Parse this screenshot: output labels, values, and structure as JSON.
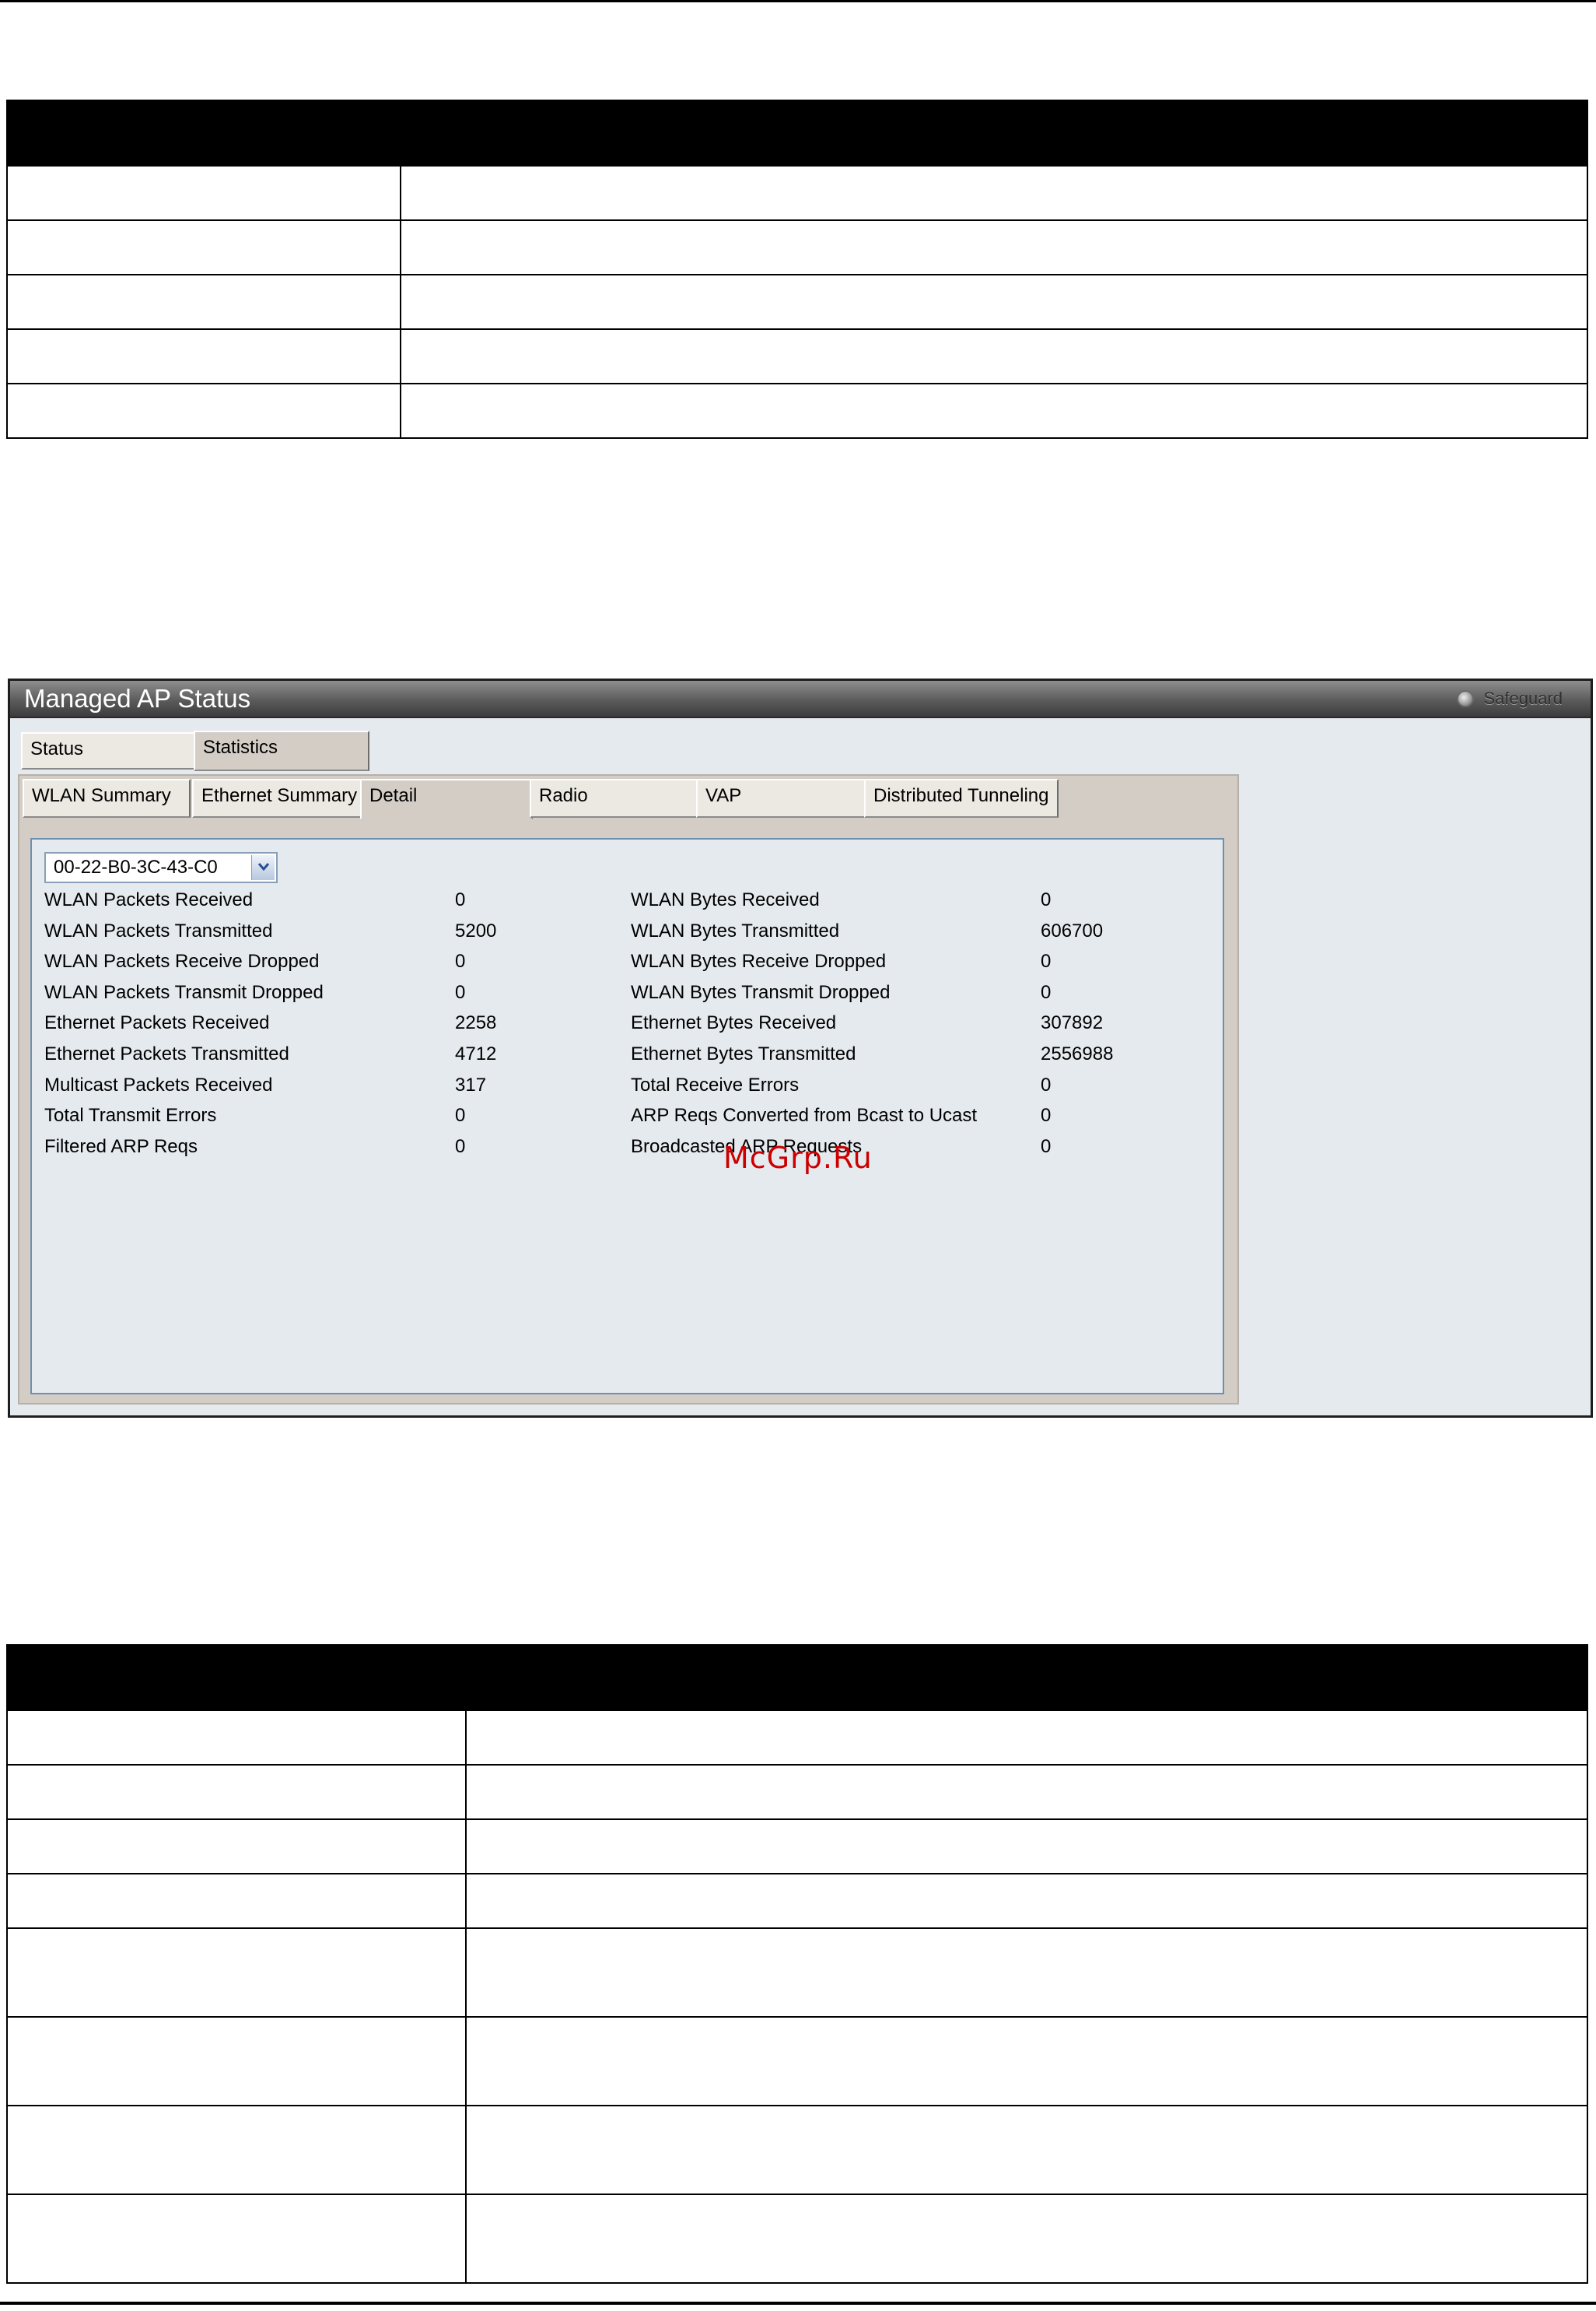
{
  "window": {
    "title": "Managed AP Status",
    "safeguard_label": "Safeguard"
  },
  "tabs": [
    {
      "label": "Status",
      "active": false
    },
    {
      "label": "Statistics",
      "active": true
    }
  ],
  "subtabs": [
    {
      "label": "WLAN Summary"
    },
    {
      "label": "Ethernet Summary"
    },
    {
      "label": "Detail",
      "active": true
    },
    {
      "label": "Radio"
    },
    {
      "label": "VAP"
    },
    {
      "label": "Distributed Tunneling"
    }
  ],
  "ap_select": {
    "value": "00-22-B0-3C-43-C0"
  },
  "stats_left": [
    {
      "label": "WLAN Packets Received",
      "value": "0"
    },
    {
      "label": "WLAN Packets Transmitted",
      "value": "5200"
    },
    {
      "label": "WLAN Packets Receive Dropped",
      "value": "0"
    },
    {
      "label": "WLAN Packets Transmit Dropped",
      "value": "0"
    },
    {
      "label": "Ethernet Packets Received",
      "value": "2258"
    },
    {
      "label": "Ethernet Packets Transmitted",
      "value": "4712"
    },
    {
      "label": "Multicast Packets Received",
      "value": "317"
    },
    {
      "label": "Total Transmit Errors",
      "value": "0"
    },
    {
      "label": "Filtered ARP Reqs",
      "value": "0"
    }
  ],
  "stats_right": [
    {
      "label": "WLAN Bytes Received",
      "value": "0"
    },
    {
      "label": "WLAN Bytes Transmitted",
      "value": "606700"
    },
    {
      "label": "WLAN Bytes Receive Dropped",
      "value": "0"
    },
    {
      "label": "WLAN Bytes Transmit Dropped",
      "value": "0"
    },
    {
      "label": "Ethernet Bytes Received",
      "value": "307892"
    },
    {
      "label": "Ethernet Bytes Transmitted",
      "value": "2556988"
    },
    {
      "label": "Total Receive Errors",
      "value": "0"
    },
    {
      "label": "ARP Reqs Converted from Bcast to Ucast",
      "value": "0"
    },
    {
      "label": "Broadcasted ARP Requests",
      "value": "0"
    }
  ],
  "watermark": "McGrp.Ru"
}
